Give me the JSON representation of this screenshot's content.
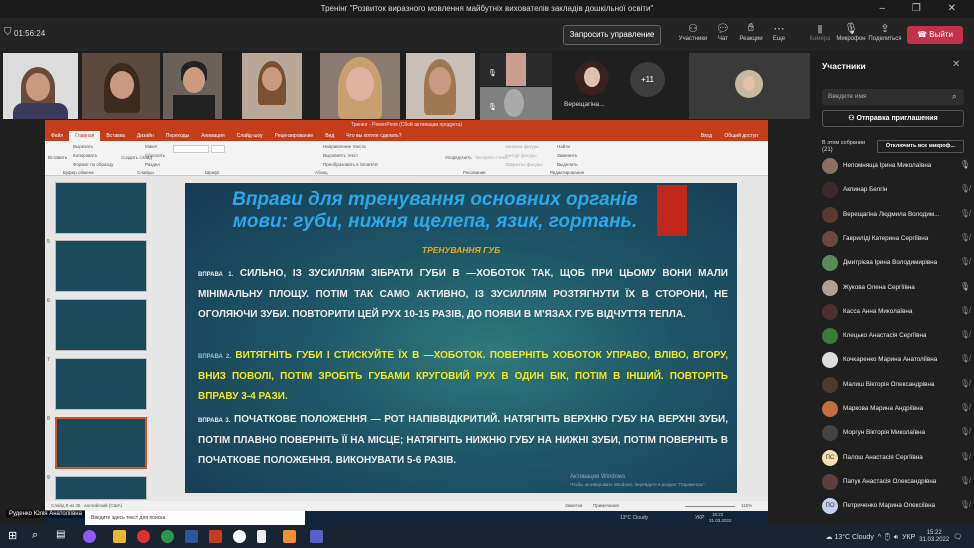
{
  "window": {
    "title": "Тренінг \"Розвиток виразного мовлення майбутніх вихователів закладів дошкільної освіти\"",
    "controls": "–  ❐  ✕"
  },
  "toolbar": {
    "timer": "01:56:24",
    "request_control": "Запросить управление",
    "buttons": [
      {
        "label": "Участники",
        "icon": "people-icon"
      },
      {
        "label": "Чат",
        "icon": "chat-icon"
      },
      {
        "label": "Реакции",
        "icon": "reaction-icon"
      },
      {
        "label": "Еще",
        "icon": "more-icon"
      },
      {
        "label": "Камера",
        "icon": "camera-off-icon"
      },
      {
        "label": "Микрофон",
        "icon": "mic-icon"
      },
      {
        "label": "Поделиться",
        "icon": "share-icon"
      }
    ],
    "leave": "Выйти"
  },
  "video": {
    "overflow": "+11",
    "tile_name": "Верещагіна..."
  },
  "panel": {
    "title": "Участники",
    "search_placeholder": "Введите имя",
    "invite": "Отправка приглашения",
    "in_meeting": "В этом собрании",
    "count": "(21)",
    "mute_all": "Отключить все микроф...",
    "participants": [
      {
        "name": "Непомняща Ірина Миколаївна",
        "mic": "on"
      },
      {
        "name": "Акпинар Белгін",
        "mic": "off"
      },
      {
        "name": "Верещагіна Людмила Володим...",
        "mic": "off"
      },
      {
        "name": "Гавриліді Катерина Сергіївна",
        "mic": "off"
      },
      {
        "name": "Дмитрієва Ірина Володимирівна",
        "mic": "off"
      },
      {
        "name": "Жукова Олена Сергіївна",
        "mic": "on"
      },
      {
        "name": "Касса Анна Миколаївна",
        "mic": "off"
      },
      {
        "name": "Клецько Анастасія Сергіївна",
        "mic": "off"
      },
      {
        "name": "Кочкаренко Марина Анатоліївна",
        "mic": "off"
      },
      {
        "name": "Малиш Вікторія Олександрівна",
        "mic": "off"
      },
      {
        "name": "Маркова Марина Андріївна",
        "mic": "off"
      },
      {
        "name": "Моргун Вікторія Миколаївна",
        "mic": "off"
      },
      {
        "name": "Палош Анастасія Сергіївна",
        "mic": "off",
        "initials": "ПС"
      },
      {
        "name": "Папук Анастасія Олександрівна",
        "mic": "off"
      },
      {
        "name": "Петриченко Марина Олексіївна",
        "mic": "off",
        "initials": "ПО"
      }
    ]
  },
  "powerpoint": {
    "title": "Тренінг - PowerPoint (Сбой активации продукта)",
    "login": "Вход",
    "share": "Общий доступ",
    "tabs": [
      "Файл",
      "Главная",
      "Вставка",
      "Дизайн",
      "Переходы",
      "Анимация",
      "Слайд-шоу",
      "Рецензирование",
      "Вид",
      "Что вы хотите сделать?"
    ],
    "ribbon": {
      "paste": "Вставить",
      "cut": "Вырезать",
      "copy": "Копировать",
      "format": "Формат по образцу",
      "clipboard": "Буфер обмена",
      "new_slide": "Создать слайд",
      "layout": "Макет",
      "reset": "Сбросить",
      "section": "Раздел",
      "slides": "Слайды",
      "font": "Шрифт",
      "paragraph": "Абзац",
      "text_dir": "Направление текста",
      "align_text": "Выровнять текст",
      "smartart": "Преобразовать в SmartArt",
      "arrange": "Упорядочить",
      "quick_styles": "Экспресс-стили",
      "fill": "Заливка фигуры",
      "outline": "Контур фигуры",
      "effects": "Эффекты фигуры",
      "drawing": "Рисование",
      "find": "Найти",
      "replace": "Заменить",
      "select": "Выделить",
      "editing": "Редактирование"
    },
    "thumb_numbers": [
      "5",
      "6",
      "7",
      "8",
      "9"
    ],
    "status": {
      "slide": "Слайд 8 из 35",
      "lang": "английский (США)",
      "notes": "Заметки",
      "comments": "Примечания",
      "zoom": "115%"
    }
  },
  "slide": {
    "title": "Вправи для тренування основних органів мови: губи, нижня щелепа, язик, гортань.",
    "subtitle": "ТРЕНУВАННЯ ГУБ",
    "ex1_label": "ВПРАВА 1.",
    "ex1": "СИЛЬНО, ІЗ ЗУСИЛЛЯМ ЗІБРАТИ ГУБИ В —ХОБОТОК  ТАК, ЩОБ ПРИ ЦЬОМУ ВОНИ МАЛИ МІНІМАЛЬНУ ПЛОЩУ. ПОТІМ ТАК САМО АКТИВНО, ІЗ ЗУСИЛЛЯМ РОЗТЯГНУТИ ЇХ В СТОРОНИ, НЕ ОГОЛЯЮЧИ ЗУБИ. ПОВТОРИТИ ЦЕЙ РУХ 10-15 РАЗІВ, ДО ПОЯВИ В М'ЯЗАХ ГУБ ВІДЧУТТЯ ТЕПЛА.",
    "ex2_label": "ВПРАВА 2.",
    "ex2": "ВИТЯГНІТЬ ГУБИ І СТИСКУЙТЕ ЇХ В —ХОБОТОК. ПОВЕРНІТЬ ХОБОТОК УПРАВО, ВЛІВО, ВГОРУ, ВНИЗ ПОВОЛІ, ПОТІМ ЗРОБІТЬ ГУБАМИ КРУГОВИЙ РУХ В ОДИН БІК, ПОТІМ В ІНШИЙ. ПОВТОРІТЬ ВПРАВУ 3-4 РАЗИ.",
    "ex3_label": "ВПРАВА 3.",
    "ex3": "ПОЧАТКОВЕ ПОЛОЖЕННЯ — РОТ НАПІВВІДКРИТИЙ. НАТЯГНІТЬ ВЕРХНЮ ГУБУ НА ВЕРХНІ ЗУБИ, ПОТІМ ПЛАВНО ПОВЕРНІТЬ ЇЇ НА МІСЦЕ; НАТЯГНІТЬ НИЖНЮ ГУБУ НА НИЖНІ ЗУБИ, ПОТІМ ПОВЕРНІТЬ В ПОЧАТКОВЕ ПОЛОЖЕННЯ. ВИКОНУВАТИ 5-6 РАЗІВ.",
    "watermark1": "Активация Windows",
    "watermark2": "Чтобы активировать Windows, перейдите в раздел \"Параметры\""
  },
  "inner_taskbar": {
    "search": "Введите здесь текст для поиска",
    "weather": "13°C Cloudy",
    "lang": "УКР",
    "time": "15:22",
    "date": "31.03.2022"
  },
  "presenter_name": "Руденко Юлія Анатоліївна",
  "taskbar": {
    "weather": "13°C Cloudy",
    "lang": "УКР",
    "time": "15:22",
    "date": "31.03.2022"
  },
  "colors": {
    "leave": "#c4314b",
    "powerpoint": "#c43e1c",
    "slide_title": "#2aa8e8",
    "highlight": "#f5e81a"
  }
}
